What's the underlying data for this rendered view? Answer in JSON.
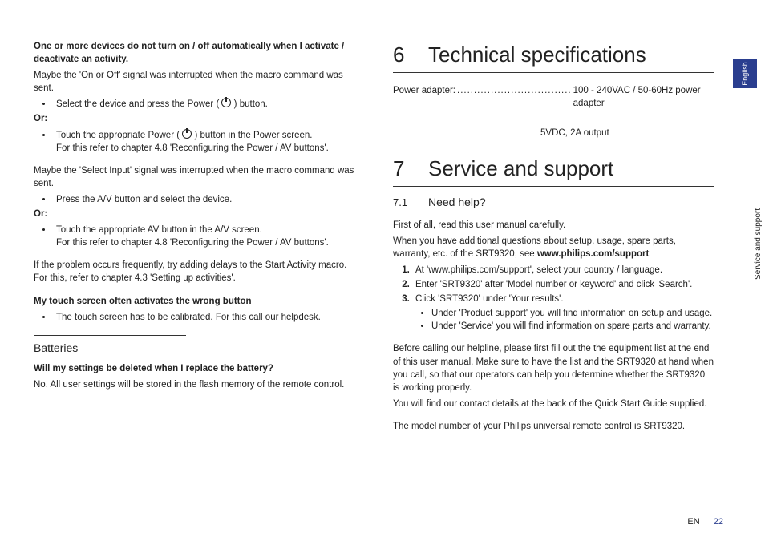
{
  "left": {
    "issue1_title": "One or more devices do not turn on / off automatically when I activate / deactivate an activity.",
    "issue1_p1": "Maybe the 'On or Off' signal was interrupted when the macro command was sent.",
    "issue1_b1_pre": "Select the device and press the Power ( ",
    "issue1_b1_post": " ) button.",
    "or": "Or:",
    "issue1_b2_pre": "Touch the appropriate Power ( ",
    "issue1_b2_post": " ) button in the Power screen.",
    "issue1_b2_l2": "For this refer to chapter 4.8 'Reconfiguring the Power / AV buttons'.",
    "issue1_p2": "Maybe the 'Select Input' signal was interrupted when the macro command was sent.",
    "issue1_b3": "Press the A/V button and select the device.",
    "issue1_b4": "Touch the appropriate AV button in the A/V screen.",
    "issue1_b4_l2": "For this refer to chapter 4.8 'Reconfiguring the Power / AV buttons'.",
    "issue1_p3": "If the problem occurs frequently, try adding delays to the Start Activity macro. For this, refer to chapter 4.3 'Setting up activities'.",
    "issue2_title": "My touch screen often activates the wrong button",
    "issue2_b1": "The touch screen has to be calibrated. For this call our helpdesk.",
    "batt_h": "Batteries",
    "batt_q": "Will my settings be deleted when I replace the battery?",
    "batt_a": "No. All user settings will be stored in the flash memory of the remote control."
  },
  "right": {
    "ch6_num": "6",
    "ch6_title": "Technical specifications",
    "spec_k": "Power adapter:",
    "spec_dots": "..................................",
    "spec_v": "100 - 240VAC / 50-60Hz power adapter",
    "spec_v2": "5VDC, 2A output",
    "ch7_num": "7",
    "ch7_title": "Service and support",
    "s71_n": "7.1",
    "s71_t": "Need help?",
    "p1": "First of all, read this user manual carefully.",
    "p2a": "When you have additional questions about setup, usage, spare parts, warranty, etc. of the SRT9320, see ",
    "p2b": "www.philips.com/support",
    "li1": "At 'www.philips.com/support', select your country / language.",
    "li2": "Enter 'SRT9320' after 'Model number or keyword' and click 'Search'.",
    "li3": "Click 'SRT9320' under 'Your results'.",
    "li3a": "Under 'Product support' you will find information on setup and usage.",
    "li3b": "Under 'Service' you will find information on spare parts and warranty.",
    "p3": "Before calling our helpline, please first fill out the the equipment list at the end of this user manual. Make sure to have the list and the SRT9320 at hand when you call, so that our operators can help you determine whether the SRT9320 is working properly.",
    "p4": "You will find our contact details at the back of the Quick Start Guide supplied.",
    "p5": "The model number of your Philips universal remote control is SRT9320."
  },
  "side": {
    "tab": "English",
    "section": "Service and support"
  },
  "footer": {
    "lang": "EN",
    "page": "22"
  }
}
